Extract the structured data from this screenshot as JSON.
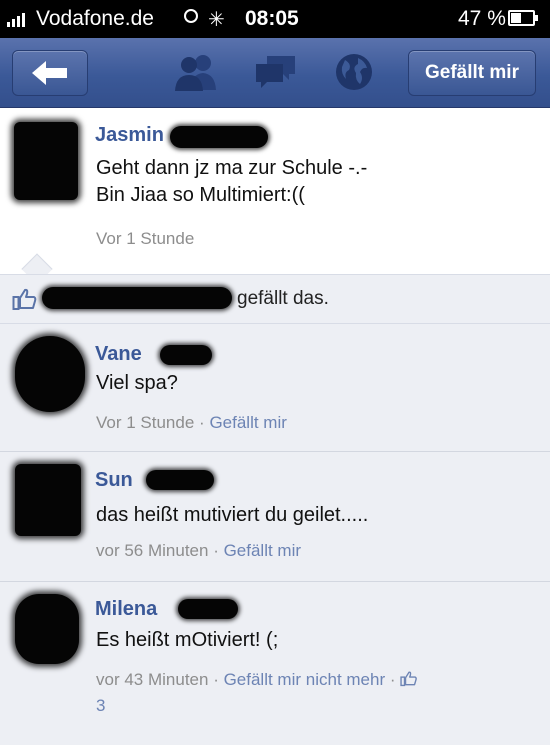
{
  "status_bar": {
    "carrier": "Vodafone.de",
    "time": "08:05",
    "battery": "47 %",
    "battery_level": 0.47
  },
  "nav": {
    "like_button": "Gefällt mir",
    "icons": [
      "back-arrow-icon",
      "friends-icon",
      "messages-icon",
      "globe-icon"
    ]
  },
  "post": {
    "author": "Jasmin",
    "lines": [
      "Geht dann jz ma zur Schule -.-",
      "Bin Jiaa so Multimiert:(("
    ],
    "time": "Vor 1 Stunde"
  },
  "likes": {
    "text": "gefällt das."
  },
  "comments": [
    {
      "author": "Vane",
      "text": "Viel spa?",
      "time": "Vor 1 Stunde",
      "like": "Gefällt mir"
    },
    {
      "author": "Sun",
      "text": "das heißt mutiviert du geilet.....",
      "time": "vor 56 Minuten",
      "like": "Gefällt mir"
    },
    {
      "author": "Milena",
      "text": "Es heißt mOtiviert! (;",
      "time": "vor 43 Minuten",
      "like": "Gefällt mir nicht mehr",
      "like_count": "3"
    }
  ],
  "colors": {
    "facebook_blue": "#3b5998",
    "link": "#6d84b4",
    "comment_bg": "#edeff4"
  }
}
